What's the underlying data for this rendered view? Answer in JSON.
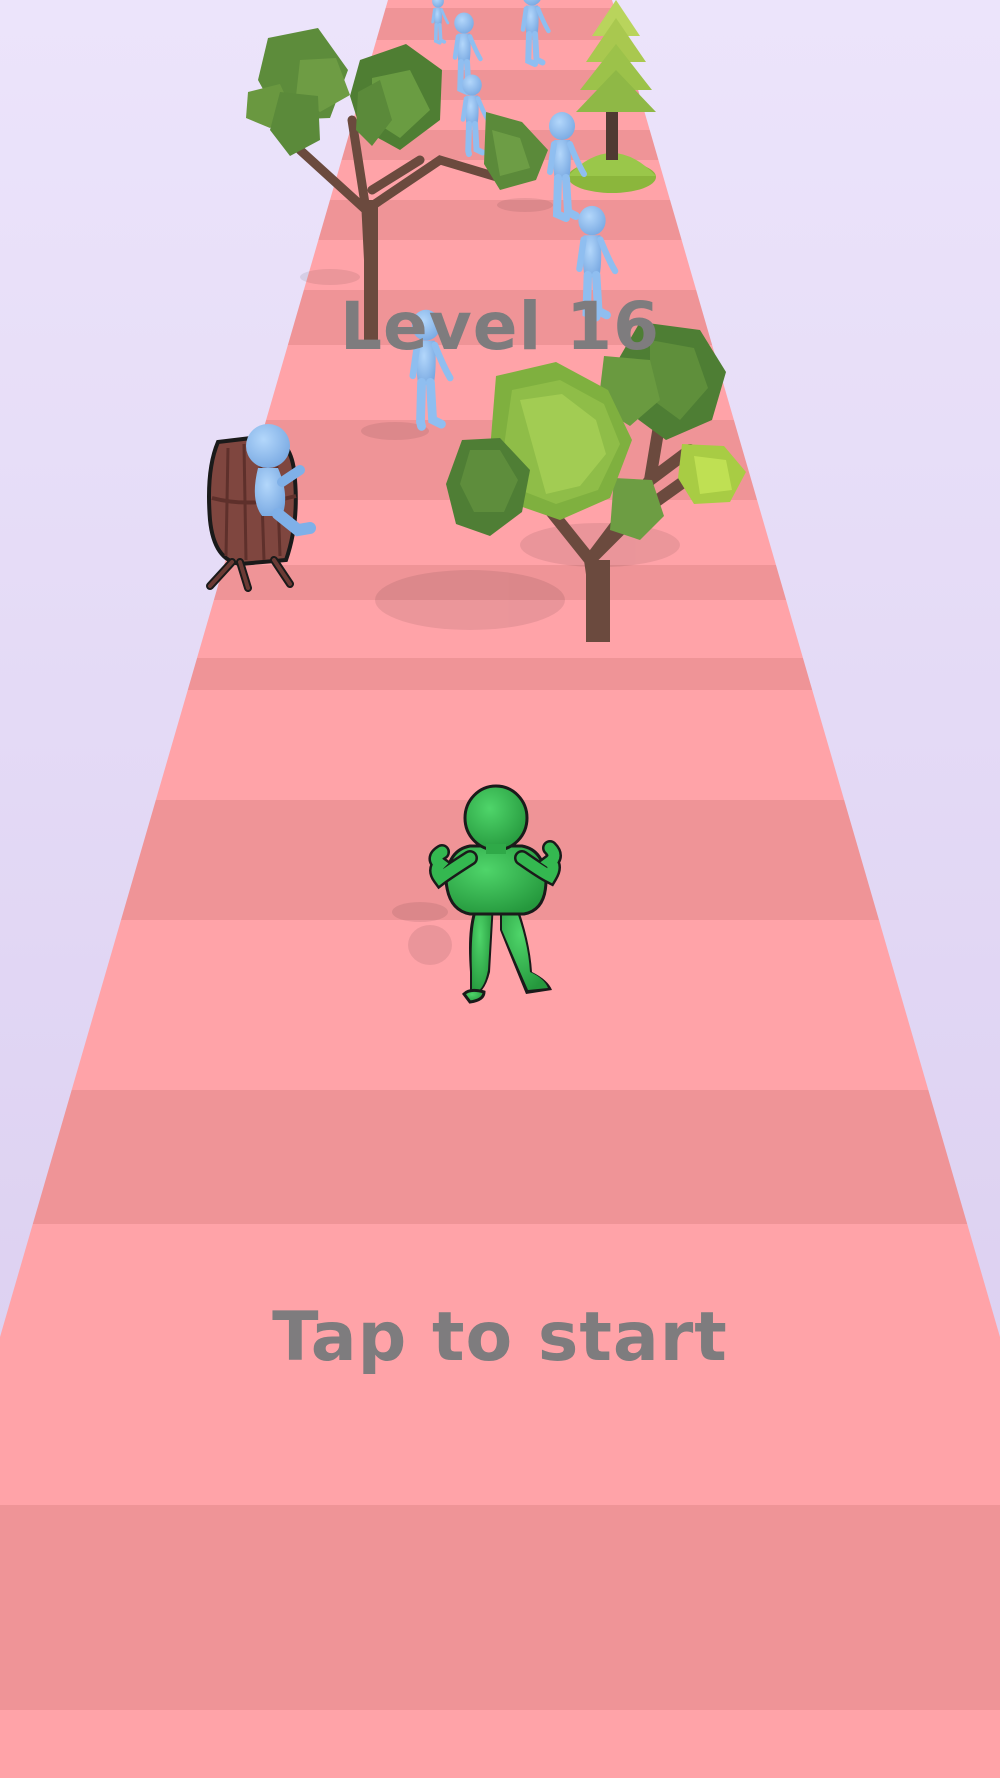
{
  "hud": {
    "level_text": "Level 16",
    "start_prompt": "Tap to start"
  },
  "colors": {
    "sky_top": "#ece4fb",
    "sky_bottom": "#d8cbee",
    "road_light": "#ffa3a8",
    "road_dark": "#ef9497",
    "overlay_text": "#7e7c7e",
    "player": "#2fb04a",
    "player_dark": "#1f8e36",
    "crowd": "#8fbef0",
    "crowd_dark": "#6a9fd8",
    "foliage_dark": "#5b8a3c",
    "foliage_light": "#9cc24a",
    "trunk": "#6b4a3e",
    "barrel": "#8a4a42"
  },
  "scene": {
    "player": {
      "name": "player-character",
      "color_key": "player"
    },
    "crowd_count": 9,
    "obstacles": [
      "deciduous-tree",
      "deciduous-tree",
      "pine-tree",
      "wooden-barrel"
    ]
  }
}
